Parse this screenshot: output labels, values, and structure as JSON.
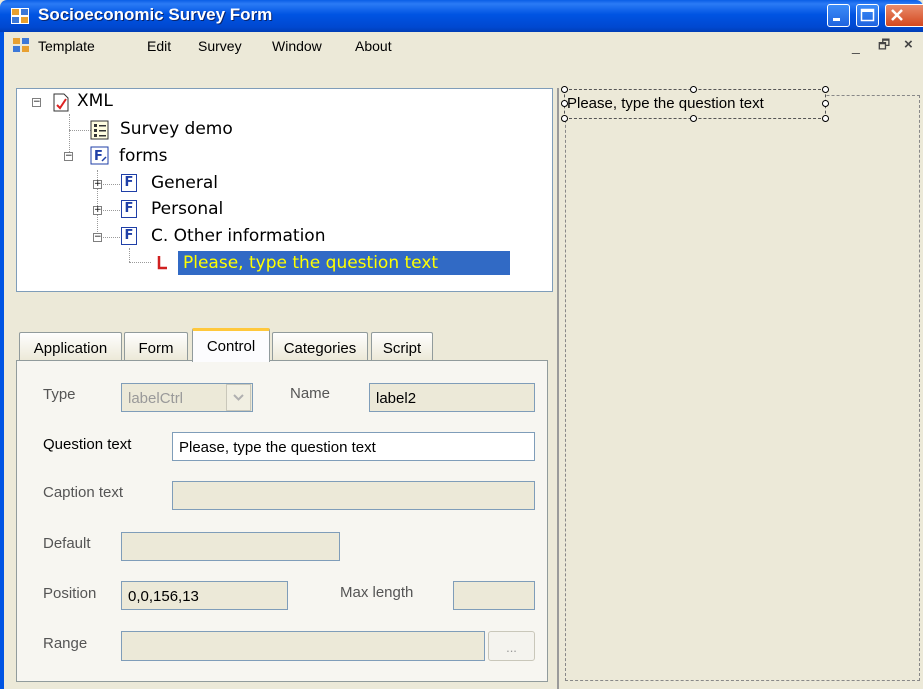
{
  "window": {
    "title": "Socioeconomic Survey Form"
  },
  "menu": {
    "items": [
      "Template",
      "Edit",
      "Survey",
      "Window",
      "About"
    ],
    "mdi_min": "_",
    "mdi_restore": "🗗",
    "mdi_close": "×"
  },
  "tree": {
    "root": "XML",
    "survey": "Survey demo",
    "forms": "forms",
    "form_general": "General",
    "form_personal": "Personal",
    "form_other": "C. Other information",
    "selected_node": "Please, type the question text",
    "expander_collapsed": "+",
    "expander_expanded": "−"
  },
  "tabs": [
    "Application",
    "Form",
    "Control",
    "Categories",
    "Script"
  ],
  "active_tab": "Control",
  "control": {
    "type_label": "Type",
    "type_value": "labelCtrl",
    "name_label": "Name",
    "name_value": "label2",
    "question_label": "Question text",
    "question_value": "Please, type the question text",
    "caption_label": "Caption text",
    "caption_value": "",
    "default_label": "Default",
    "default_value": "",
    "position_label": "Position",
    "position_value": "0,0,156,13",
    "maxlen_label": "Max length",
    "maxlen_value": "",
    "range_label": "Range",
    "range_value": "",
    "range_button": "..."
  },
  "design": {
    "label_text": "Please, type the question text"
  },
  "icon_names": [
    "app-icon",
    "xml-doc-icon",
    "survey-icon",
    "forms-icon",
    "form-icon",
    "label-icon"
  ],
  "colors": {
    "titlebar": "#0054e3",
    "selection": "#316ac5",
    "selection_text": "#ffff00",
    "active_tab_accent": "#ffc83c"
  }
}
